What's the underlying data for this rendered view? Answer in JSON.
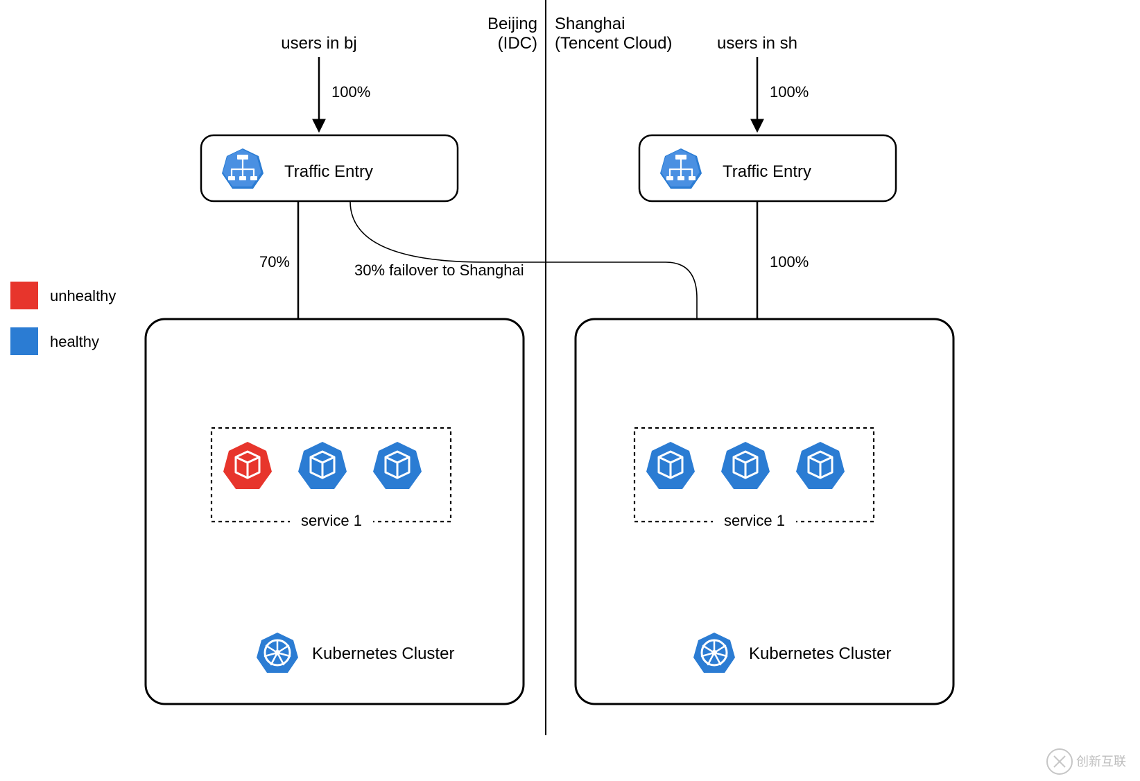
{
  "regions": {
    "left": {
      "title_line1": "Beijing",
      "title_line2": "(IDC)"
    },
    "right": {
      "title_line1": "Shanghai",
      "title_line2": "(Tencent Cloud)"
    }
  },
  "users": {
    "left": "users in bj",
    "right": "users in sh"
  },
  "traffic_entry_label": "Traffic Entry",
  "percentages": {
    "left_in": "100%",
    "right_in": "100%",
    "left_down": "70%",
    "failover": "30% failover to Shanghai",
    "right_down": "100%"
  },
  "service_label": "service 1",
  "cluster_label": "Kubernetes Cluster",
  "legend": {
    "unhealthy": "unhealthy",
    "healthy": "healthy"
  },
  "watermark": "创新互联",
  "colors": {
    "healthy": "#2B7CD3",
    "unhealthy": "#E7352C",
    "healthy_light": "#4A90E2"
  },
  "pods": {
    "left": [
      "unhealthy",
      "healthy",
      "healthy"
    ],
    "right": [
      "healthy",
      "healthy",
      "healthy"
    ]
  }
}
